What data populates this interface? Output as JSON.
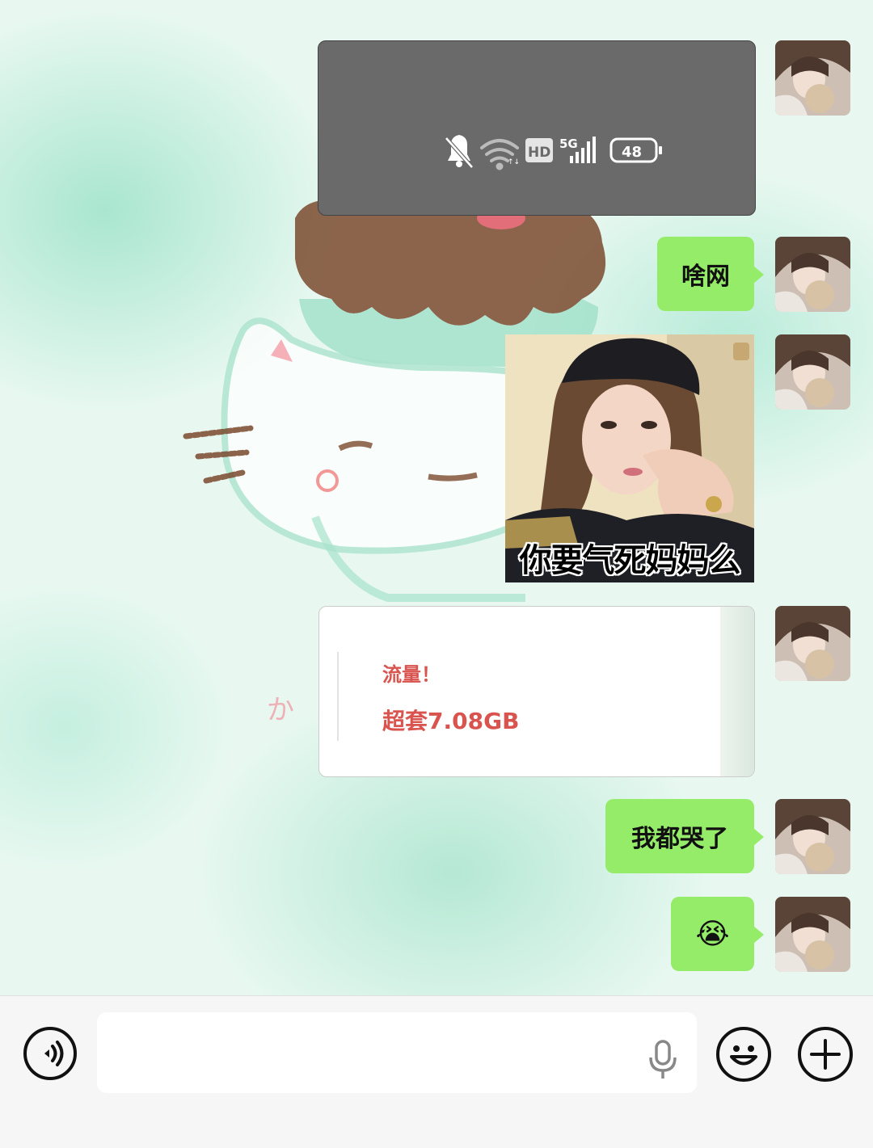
{
  "status_bar_screenshot": {
    "network_badge": "HD",
    "signal_label": "5G",
    "battery": "48"
  },
  "messages": [
    {
      "type": "image",
      "kind": "status-bar-screenshot"
    },
    {
      "type": "text",
      "text": "啥网"
    },
    {
      "type": "sticker",
      "caption": "你要气死妈妈么"
    },
    {
      "type": "card",
      "line1": "流量！",
      "line2": "超套7.08GB"
    },
    {
      "type": "text",
      "text": "我都哭了"
    },
    {
      "type": "emoji",
      "text": "😭"
    }
  ],
  "input_bar": {
    "voice_icon": "voice-toggle-icon",
    "mic_icon": "microphone-icon",
    "emoji_icon": "emoji-icon",
    "plus_icon": "plus-icon",
    "input_value": ""
  },
  "colors": {
    "sent_bubble": "#95ec69",
    "card_text": "#d9544f",
    "input_bar_bg": "#f6f6f6"
  }
}
